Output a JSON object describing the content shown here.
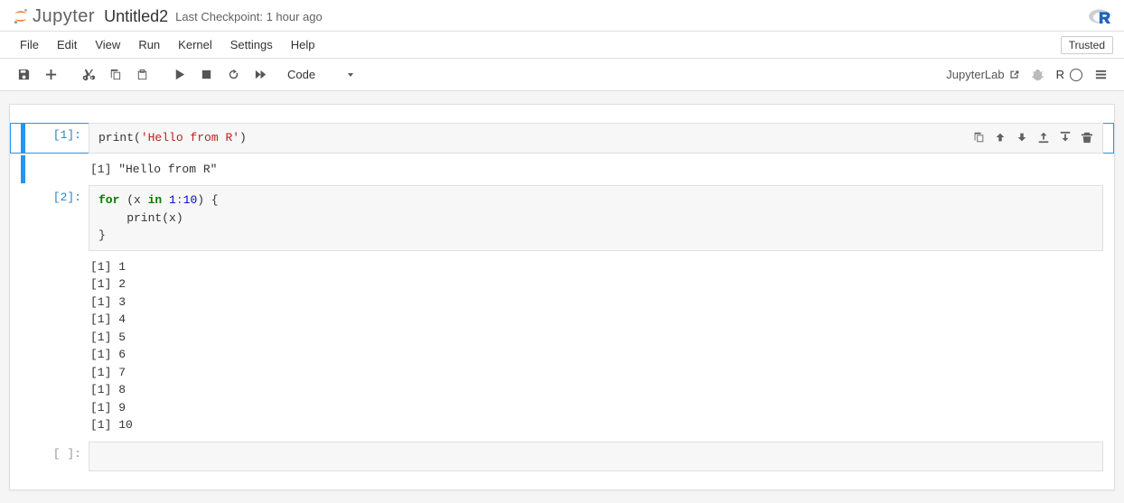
{
  "header": {
    "logo_text": "Jupyter",
    "title": "Untitled2",
    "checkpoint": "Last Checkpoint: 1 hour ago"
  },
  "menu": {
    "items": [
      "File",
      "Edit",
      "View",
      "Run",
      "Kernel",
      "Settings",
      "Help"
    ],
    "trusted": "Trusted"
  },
  "toolbar": {
    "celltype": "Code",
    "jlab_link": "JupyterLab",
    "kernel_name": "R"
  },
  "cells": [
    {
      "exec_count": "1",
      "code_segments": [
        {
          "t": "print",
          "c": "r-fn"
        },
        {
          "t": "(",
          "c": ""
        },
        {
          "t": "'Hello from R'",
          "c": "r-str"
        },
        {
          "t": ")",
          "c": ""
        }
      ],
      "output": "[1] \"Hello from R\"",
      "active": true,
      "selected": true
    },
    {
      "exec_count": "2",
      "code_segments": [
        {
          "t": "for",
          "c": "r-kw"
        },
        {
          "t": " (x ",
          "c": ""
        },
        {
          "t": "in",
          "c": "r-kw"
        },
        {
          "t": " ",
          "c": ""
        },
        {
          "t": "1",
          "c": "r-num"
        },
        {
          "t": ":",
          "c": "r-op"
        },
        {
          "t": "10",
          "c": "r-num"
        },
        {
          "t": ") {\n    print(x)\n}",
          "c": ""
        }
      ],
      "output": "[1] 1\n[1] 2\n[1] 3\n[1] 4\n[1] 5\n[1] 6\n[1] 7\n[1] 8\n[1] 9\n[1] 10",
      "active": false,
      "selected": false
    },
    {
      "exec_count": "",
      "code_segments": [],
      "output": null,
      "active": false,
      "selected": false
    }
  ],
  "cell_toolbar_icons": [
    "duplicate",
    "move-up",
    "move-down",
    "insert-above",
    "insert-below",
    "delete"
  ]
}
